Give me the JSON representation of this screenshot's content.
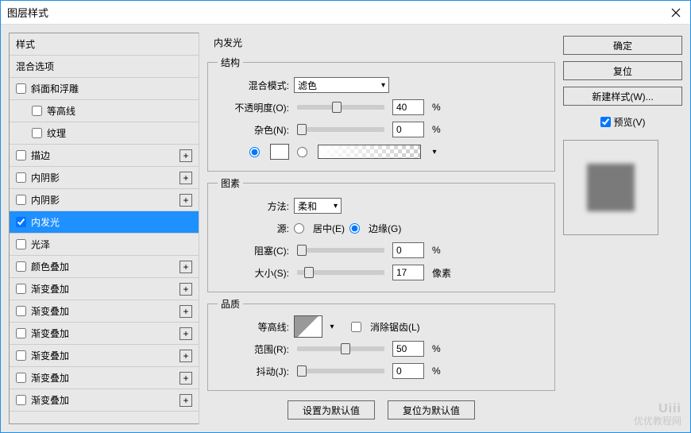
{
  "title": "图层样式",
  "sidebar": {
    "header": "样式",
    "blend": "混合选项",
    "items": [
      {
        "label": "斜面和浮雕",
        "checked": false,
        "indent": false,
        "add": false
      },
      {
        "label": "等高线",
        "checked": false,
        "indent": true,
        "add": false
      },
      {
        "label": "纹理",
        "checked": false,
        "indent": true,
        "add": false
      },
      {
        "label": "描边",
        "checked": false,
        "indent": false,
        "add": true
      },
      {
        "label": "内阴影",
        "checked": false,
        "indent": false,
        "add": true
      },
      {
        "label": "内阴影",
        "checked": false,
        "indent": false,
        "add": true
      },
      {
        "label": "内发光",
        "checked": true,
        "indent": false,
        "add": false,
        "selected": true
      },
      {
        "label": "光泽",
        "checked": false,
        "indent": false,
        "add": false
      },
      {
        "label": "颜色叠加",
        "checked": false,
        "indent": false,
        "add": true
      },
      {
        "label": "渐变叠加",
        "checked": false,
        "indent": false,
        "add": true
      },
      {
        "label": "渐变叠加",
        "checked": false,
        "indent": false,
        "add": true
      },
      {
        "label": "渐变叠加",
        "checked": false,
        "indent": false,
        "add": true
      },
      {
        "label": "渐变叠加",
        "checked": false,
        "indent": false,
        "add": true
      },
      {
        "label": "渐变叠加",
        "checked": false,
        "indent": false,
        "add": true
      },
      {
        "label": "渐变叠加",
        "checked": false,
        "indent": false,
        "add": true
      }
    ]
  },
  "panel": {
    "title": "内发光",
    "structure": {
      "legend": "结构",
      "blend_label": "混合模式:",
      "blend_value": "滤色",
      "opacity_label": "不透明度(O):",
      "opacity_value": "40",
      "opacity_unit": "%",
      "noise_label": "杂色(N):",
      "noise_value": "0",
      "noise_unit": "%"
    },
    "element": {
      "legend": "图素",
      "method_label": "方法:",
      "method_value": "柔和",
      "source_label": "源:",
      "source_center": "居中(E)",
      "source_edge": "边缘(G)",
      "choke_label": "阻塞(C):",
      "choke_value": "0",
      "choke_unit": "%",
      "size_label": "大小(S):",
      "size_value": "17",
      "size_unit": "像素"
    },
    "quality": {
      "legend": "品质",
      "contour_label": "等高线:",
      "antialias": "消除锯齿(L)",
      "range_label": "范围(R):",
      "range_value": "50",
      "range_unit": "%",
      "jitter_label": "抖动(J):",
      "jitter_value": "0",
      "jitter_unit": "%"
    },
    "buttons": {
      "default": "设置为默认值",
      "reset": "复位为默认值"
    }
  },
  "actions": {
    "ok": "确定",
    "cancel": "复位",
    "newstyle": "新建样式(W)...",
    "preview": "预览(V)"
  },
  "watermark": {
    "brand": "Uiii",
    "sub": "优优教程网"
  }
}
